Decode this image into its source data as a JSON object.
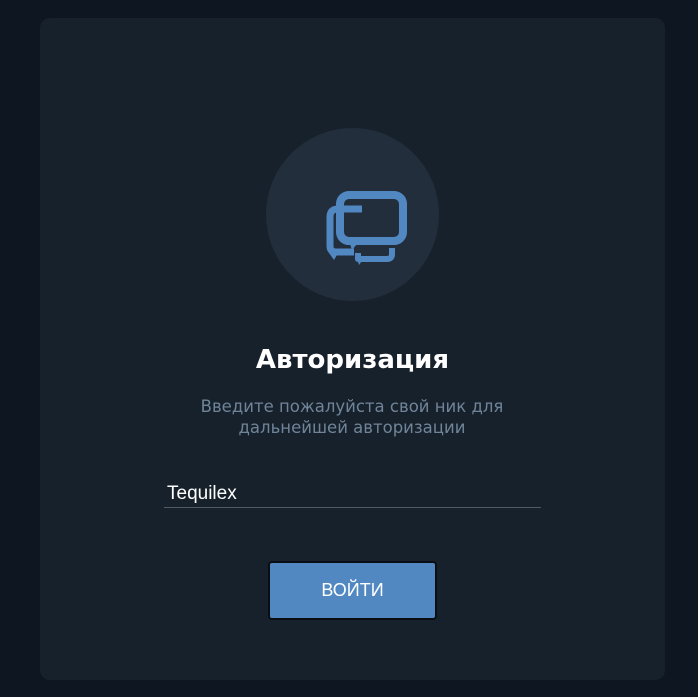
{
  "logo": {
    "icon": "chat-bubbles-icon",
    "color": "#5288c1"
  },
  "auth": {
    "title": "Авторизация",
    "subtitle": "Введите пожалуйста свой ник для дальнейшей авторизации",
    "nick_value": "Tequilex",
    "login_label": "ВОЙТИ"
  },
  "colors": {
    "page_background": "#0e1621",
    "card_background": "#17212b",
    "accent": "#5288c1",
    "muted_text": "#708499"
  }
}
